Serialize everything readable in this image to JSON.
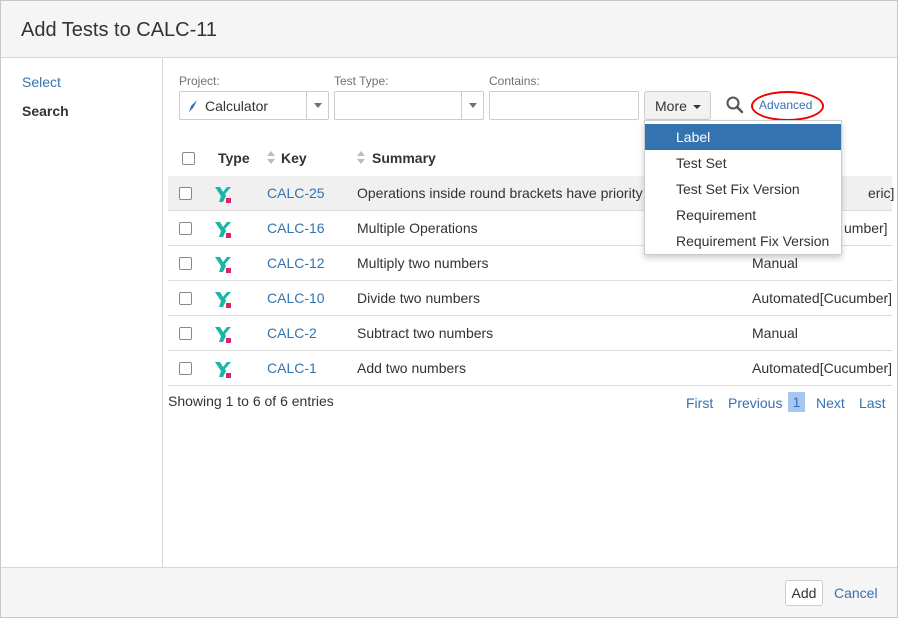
{
  "dialog": {
    "title": "Add Tests to CALC-11"
  },
  "sidebar": {
    "select_label": "Select",
    "search_label": "Search"
  },
  "filters": {
    "project_label": "Project:",
    "project_value": "Calculator",
    "test_type_label": "Test Type:",
    "test_type_value": "",
    "contains_label": "Contains:",
    "contains_value": "",
    "more_label": "More",
    "advanced_label": "Advanced"
  },
  "more_menu": {
    "items": [
      {
        "label": "Label",
        "active": true
      },
      {
        "label": "Test Set"
      },
      {
        "label": "Test Set Fix Version"
      },
      {
        "label": "Requirement"
      },
      {
        "label": "Requirement Fix Version"
      }
    ]
  },
  "table": {
    "headers": {
      "type": "Type",
      "key": "Key",
      "summary": "Summary"
    },
    "rows": [
      {
        "key": "CALC-25",
        "summary": "Operations inside round brackets have priority",
        "test_type": "eric]"
      },
      {
        "key": "CALC-16",
        "summary": "Multiple Operations",
        "test_type": "umber]"
      },
      {
        "key": "CALC-12",
        "summary": "Multiply two numbers",
        "test_type": "Manual"
      },
      {
        "key": "CALC-10",
        "summary": "Divide two numbers",
        "test_type": "Automated[Cucumber]"
      },
      {
        "key": "CALC-2",
        "summary": "Subtract two numbers",
        "test_type": "Manual"
      },
      {
        "key": "CALC-1",
        "summary": "Add two numbers",
        "test_type": "Automated[Cucumber]"
      }
    ]
  },
  "pagination": {
    "info": "Showing 1 to 6 of 6 entries",
    "first": "First",
    "previous": "Previous",
    "current": "1",
    "next": "Next",
    "last": "Last"
  },
  "footer": {
    "add_label": "Add",
    "cancel_label": "Cancel"
  },
  "colors": {
    "link": "#3572b0",
    "active_menu": "#3572b0",
    "highlight_ring": "#e00000",
    "type_icon_teal": "#1bb5a6",
    "type_icon_pink": "#d6246e"
  }
}
